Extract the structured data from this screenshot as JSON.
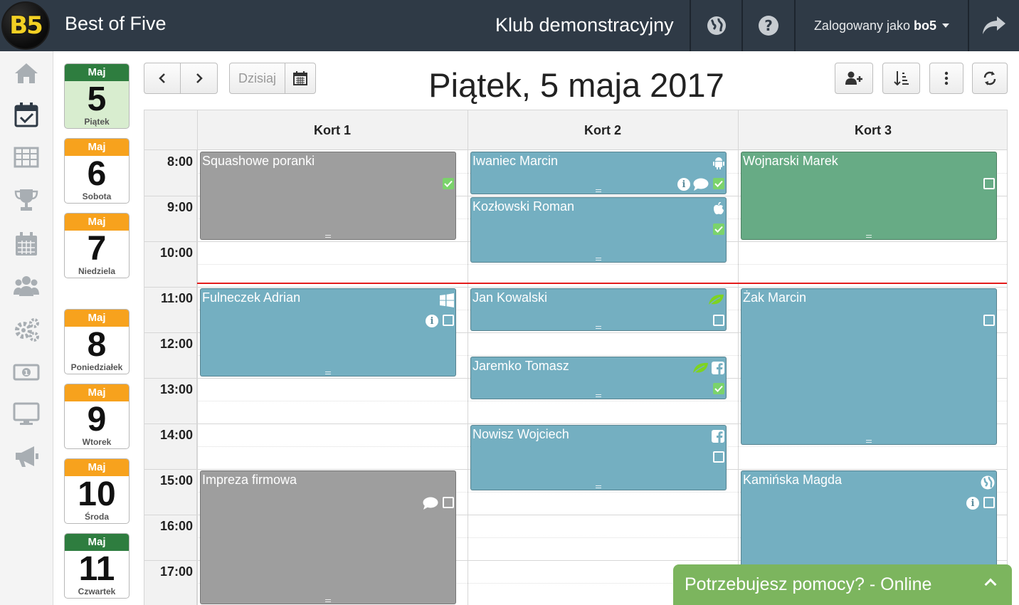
{
  "header": {
    "logo_text": "B5",
    "app_title": "Best of Five",
    "club_name": "Klub demonstracyjny",
    "user_prefix": "Zalogowany jako",
    "user_name": "bo5"
  },
  "day_strip": [
    {
      "month": "Maj",
      "day": "5",
      "weekday": "Piątek",
      "color": "green",
      "active": true
    },
    {
      "month": "Maj",
      "day": "6",
      "weekday": "Sobota",
      "color": "orange",
      "active": false
    },
    {
      "month": "Maj",
      "day": "7",
      "weekday": "Niedziela",
      "color": "orange",
      "active": false
    },
    {
      "month": "Maj",
      "day": "8",
      "weekday": "Poniedziałek",
      "color": "orange",
      "active": false
    },
    {
      "month": "Maj",
      "day": "9",
      "weekday": "Wtorek",
      "color": "orange",
      "active": false
    },
    {
      "month": "Maj",
      "day": "10",
      "weekday": "Środa",
      "color": "orange",
      "active": false
    },
    {
      "month": "Maj",
      "day": "11",
      "weekday": "Czwartek",
      "color": "green",
      "active": false
    }
  ],
  "toolbar": {
    "today_label": "Dzisiaj",
    "title": "Piątek, 5 maja 2017"
  },
  "schedule": {
    "courts": [
      "Kort 1",
      "Kort 2",
      "Kort 3"
    ],
    "hours": [
      "8:00",
      "9:00",
      "10:00",
      "11:00",
      "12:00",
      "13:00",
      "14:00",
      "15:00",
      "16:00",
      "17:00"
    ],
    "events": [
      {
        "title": "Squashowe poranki",
        "court": 0,
        "start": "8:00",
        "end": "10:00",
        "color": "gray",
        "checked": true
      },
      {
        "title": "Iwaniec Marcin",
        "court": 1,
        "start": "8:00",
        "end": "9:00",
        "color": "blue",
        "checked": true,
        "source": "android-icon",
        "info": true,
        "comment": true
      },
      {
        "title": "Kozłowski Roman",
        "court": 1,
        "start": "9:00",
        "end": "10:30",
        "color": "blue",
        "checked": true,
        "source": "apple-icon"
      },
      {
        "title": "Wojnarski Marek",
        "court": 2,
        "start": "8:00",
        "end": "10:00",
        "color": "green",
        "checked": false
      },
      {
        "title": "Fulneczek Adrian",
        "court": 0,
        "start": "11:00",
        "end": "13:00",
        "color": "blue",
        "checked": false,
        "source": "windows-icon",
        "info": true
      },
      {
        "title": "Jan Kowalski",
        "court": 1,
        "start": "11:00",
        "end": "12:00",
        "color": "blue",
        "checked": false,
        "source": "leaf-icon"
      },
      {
        "title": "Jaremko Tomasz",
        "court": 1,
        "start": "12:30",
        "end": "13:30",
        "color": "blue",
        "checked": true,
        "source": "leaf-facebook-icon"
      },
      {
        "title": "Żak Marcin",
        "court": 2,
        "start": "11:00",
        "end": "14:30",
        "color": "blue",
        "checked": false
      },
      {
        "title": "Nowisz Wojciech",
        "court": 1,
        "start": "14:00",
        "end": "15:30",
        "color": "blue",
        "checked": false,
        "source": "facebook-icon"
      },
      {
        "title": "Impreza firmowa",
        "court": 0,
        "start": "15:00",
        "end": "18:00",
        "color": "gray",
        "checked": false,
        "comment": true
      },
      {
        "title": "Kamińska Magda",
        "court": 2,
        "start": "15:00",
        "end": "18:00",
        "color": "blue",
        "checked": false,
        "source": "globe-icon",
        "info": true
      }
    ],
    "current_time": "10:55"
  },
  "help_chat": {
    "label": "Potrzebujesz pomocy? - Online"
  },
  "colors": {
    "topbar": "#2f3a46",
    "event_gray": "#9e9e9e",
    "event_blue": "#74afc1",
    "event_green": "#67ab85",
    "now_line": "#e31b1b",
    "help": "#7cb55e"
  }
}
